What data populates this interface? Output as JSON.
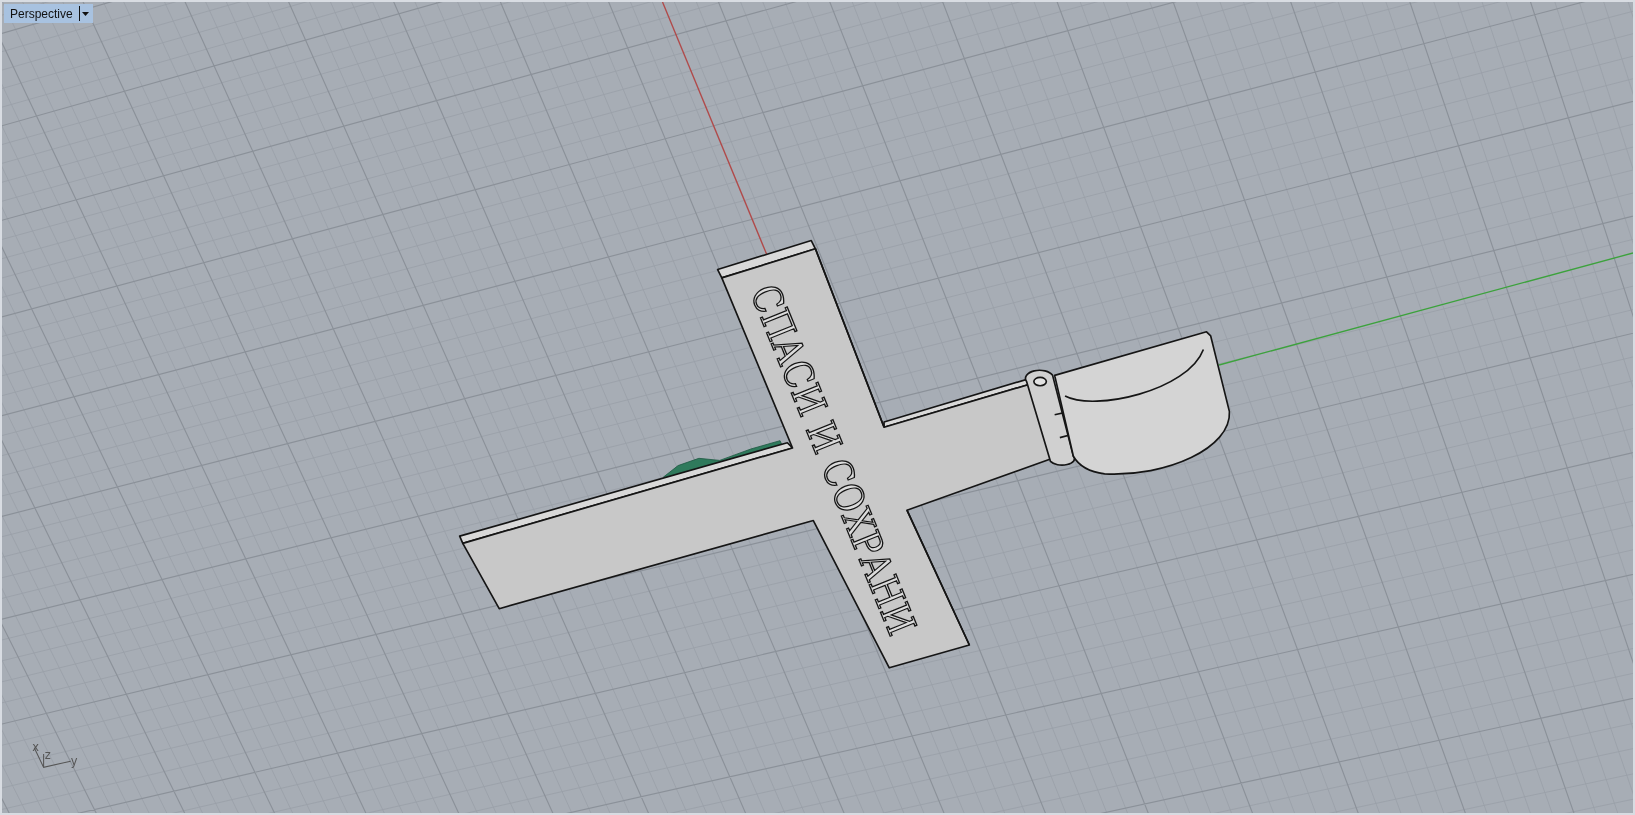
{
  "viewport": {
    "title": "Perspective",
    "engraving": "СПАСИ И СОХРАНИ",
    "axis_labels": [
      "x",
      "z",
      "y"
    ]
  }
}
